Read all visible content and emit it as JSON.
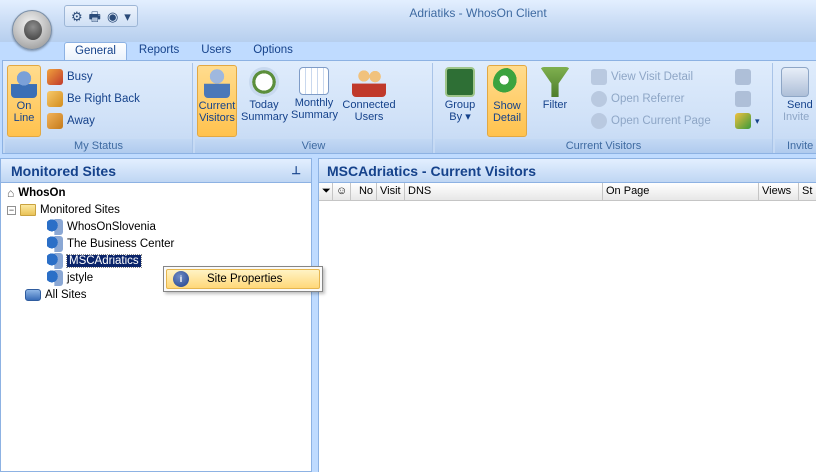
{
  "window": {
    "title": "Adriatiks - WhosOn Client"
  },
  "quick_access": {
    "icons": [
      "gears-icon",
      "printer-icon",
      "status-icon"
    ],
    "dropdown": "▾"
  },
  "tabs": [
    {
      "label": "General",
      "active": true
    },
    {
      "label": "Reports",
      "active": false
    },
    {
      "label": "Users",
      "active": false
    },
    {
      "label": "Options",
      "active": false
    }
  ],
  "ribbon": {
    "my_status": {
      "label": "My Status",
      "on_line": {
        "line1": "On",
        "line2": "Line"
      },
      "busy": "Busy",
      "be_right_back": "Be Right Back",
      "away": "Away"
    },
    "view": {
      "label": "View",
      "current_visitors": {
        "line1": "Current",
        "line2": "Visitors"
      },
      "today_summary": {
        "line1": "Today",
        "line2": "Summary"
      },
      "monthly_summary": {
        "line1": "Monthly",
        "line2": "Summary"
      },
      "connected_users": {
        "line1": "Connected",
        "line2": "Users"
      }
    },
    "current_visitors": {
      "label": "Current Visitors",
      "group_by": {
        "line1": "Group",
        "line2": "By"
      },
      "show_detail": {
        "line1": "Show",
        "line2": "Detail"
      },
      "filter": "Filter",
      "view_visit_detail": "View Visit Detail",
      "open_referrer": "Open Referrer",
      "open_current_page": "Open Current Page"
    },
    "invite": {
      "label": "Invite",
      "send_invite": {
        "line1": "Send",
        "line2": "Invite"
      }
    }
  },
  "left_pane": {
    "title": "Monitored Sites",
    "pin": "ᵖ",
    "tree": {
      "root": "WhosOn",
      "monitored_sites": "Monitored Sites",
      "sites": [
        "WhosOnSlovenia",
        "The Business Center",
        "MSCAdriatics",
        "jstyle"
      ],
      "selected_index": 2,
      "all_sites": "All Sites"
    }
  },
  "context_menu": {
    "item": "Site Properties"
  },
  "right_pane": {
    "title": "MSCAdriatics - Current Visitors",
    "columns": [
      "No",
      "Visit",
      "DNS",
      "On Page",
      "Views",
      "St"
    ]
  },
  "colors": {
    "accent": "#15428b",
    "ribbon_bg": "#d1e2f8",
    "highlight": "#ffc24e",
    "selection": "#0a246a"
  }
}
